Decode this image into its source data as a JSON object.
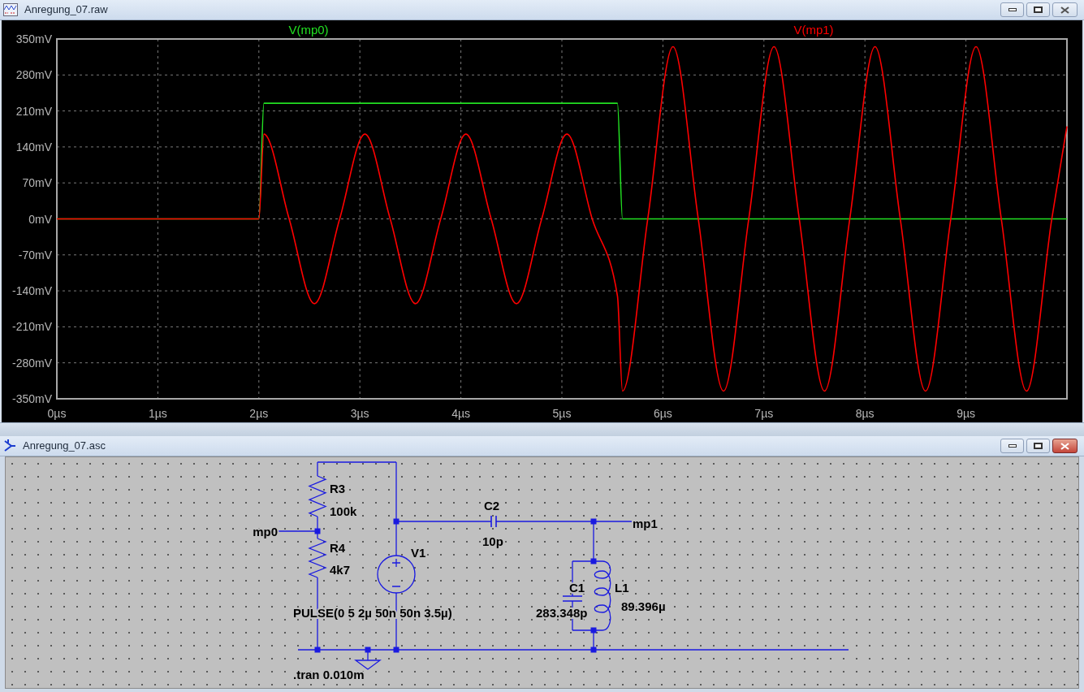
{
  "windows": [
    {
      "title": "Anregung_07.raw",
      "active": false,
      "chart_data": {
        "type": "line",
        "grid": true,
        "xlim": [
          0,
          10
        ],
        "ylim": [
          -350,
          350
        ],
        "x": [
          0,
          2.0,
          2.05,
          2.3,
          2.55,
          2.8,
          3.05,
          3.3,
          3.55,
          3.8,
          4.05,
          4.3,
          4.55,
          4.8,
          5.05,
          5.3,
          5.55,
          5.6,
          5.85,
          6.1,
          6.35,
          6.6,
          6.85,
          7.1,
          7.35,
          7.6,
          7.85,
          8.1,
          8.35,
          8.6,
          8.85,
          9.1,
          9.35,
          9.6,
          9.85,
          10.0
        ],
        "series": [
          {
            "name": "V(mp0)",
            "color": "#22e022",
            "values": [
              0,
              0,
              225,
              225,
              225,
              225,
              225,
              225,
              225,
              225,
              225,
              225,
              225,
              225,
              225,
              225,
              225,
              0,
              0,
              0,
              0,
              0,
              0,
              0,
              0,
              0,
              0,
              0,
              0,
              0,
              0,
              0,
              0,
              0,
              0,
              0
            ]
          },
          {
            "name": "V(mp1)",
            "color": "#ff0000",
            "values": [
              0,
              0,
              165,
              0,
              -165,
              0,
              165,
              0,
              -165,
              0,
              165,
              0,
              -165,
              0,
              165,
              0,
              -150,
              -335,
              0,
              335,
              0,
              -335,
              0,
              335,
              0,
              -335,
              0,
              335,
              0,
              -335,
              0,
              335,
              0,
              -335,
              0,
              180
            ]
          }
        ],
        "xticks": [
          {
            "value": 0,
            "label": "0µs"
          },
          {
            "value": 1,
            "label": "1µs"
          },
          {
            "value": 2,
            "label": "2µs"
          },
          {
            "value": 3,
            "label": "3µs"
          },
          {
            "value": 4,
            "label": "4µs"
          },
          {
            "value": 5,
            "label": "5µs"
          },
          {
            "value": 6,
            "label": "6µs"
          },
          {
            "value": 7,
            "label": "7µs"
          },
          {
            "value": 8,
            "label": "8µs"
          },
          {
            "value": 9,
            "label": "9µs"
          }
        ],
        "yticks": [
          {
            "value": 350,
            "label": "350mV"
          },
          {
            "value": 280,
            "label": "280mV"
          },
          {
            "value": 210,
            "label": "210mV"
          },
          {
            "value": 140,
            "label": "140mV"
          },
          {
            "value": 70,
            "label": "70mV"
          },
          {
            "value": 0,
            "label": "0mV"
          },
          {
            "value": -70,
            "label": "-70mV"
          },
          {
            "value": -140,
            "label": "-140mV"
          },
          {
            "value": -210,
            "label": "-210mV"
          },
          {
            "value": -280,
            "label": "-280mV"
          },
          {
            "value": -350,
            "label": "-350mV"
          }
        ]
      }
    },
    {
      "title": "Anregung_07.asc",
      "active": true,
      "schematic": {
        "components": [
          {
            "kind": "resistor",
            "name": "R3",
            "value": "100k"
          },
          {
            "kind": "resistor",
            "name": "R4",
            "value": "4k7"
          },
          {
            "kind": "voltage_source",
            "name": "V1",
            "value": "PULSE(0 5 2µ 50n 50n 3.5µ)"
          },
          {
            "kind": "capacitor_h",
            "name": "C2",
            "value": "10p"
          },
          {
            "kind": "capacitor_v",
            "name": "C1",
            "value": "283.348p"
          },
          {
            "kind": "inductor",
            "name": "L1",
            "value": "89.396µ"
          }
        ],
        "net_labels": [
          "mp0",
          "mp1"
        ],
        "directive": ".tran 0.010m"
      }
    }
  ]
}
